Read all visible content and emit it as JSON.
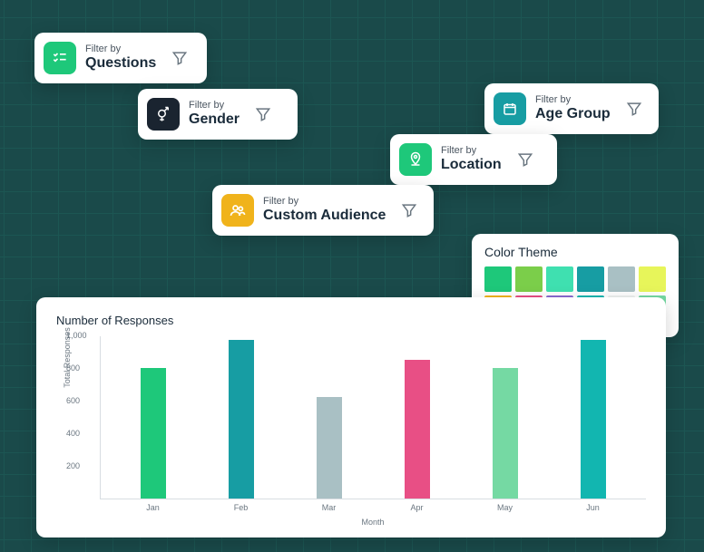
{
  "filters": [
    {
      "pretext": "Filter by",
      "label": "Questions",
      "icon": "checklist-icon",
      "icon_bg": "#1ec87a"
    },
    {
      "pretext": "Filter by",
      "label": "Gender",
      "icon": "gender-icon",
      "icon_bg": "#1a2430"
    },
    {
      "pretext": "Filter by",
      "label": "Age Group",
      "icon": "calendar-icon",
      "icon_bg": "#179da3"
    },
    {
      "pretext": "Filter by",
      "label": "Location",
      "icon": "pin-icon",
      "icon_bg": "#1ec87a"
    },
    {
      "pretext": "Filter by",
      "label": "Custom Audience",
      "icon": "people-icon",
      "icon_bg": "#f0b31b"
    }
  ],
  "color_theme": {
    "title": "Color Theme",
    "swatches": [
      [
        "#1ec87a",
        "#7bce4a",
        "#3fe0b0",
        "#179da3",
        "#a9c0c4",
        "#e7f55a"
      ],
      [
        "#f0b31b",
        "#e84f85",
        "#8a6bd1",
        "#12b6b0",
        "#eef1f0",
        "#75d9a3"
      ]
    ]
  },
  "chart_data": {
    "type": "bar",
    "title": "Number of Responses",
    "xlabel": "Month",
    "ylabel": "Total Responses",
    "ylim": [
      0,
      1000
    ],
    "yticks": [
      200,
      400,
      600,
      800,
      1000
    ],
    "ytick_labels": [
      "200",
      "400",
      "600",
      "800",
      "1,000"
    ],
    "categories": [
      "Jan",
      "Feb",
      "Mar",
      "Apr",
      "May",
      "Jun"
    ],
    "values": [
      800,
      970,
      620,
      850,
      800,
      970
    ],
    "colors": [
      "#1ec87a",
      "#179da3",
      "#a9c0c4",
      "#e84f85",
      "#75d9a3",
      "#12b6b0"
    ]
  }
}
